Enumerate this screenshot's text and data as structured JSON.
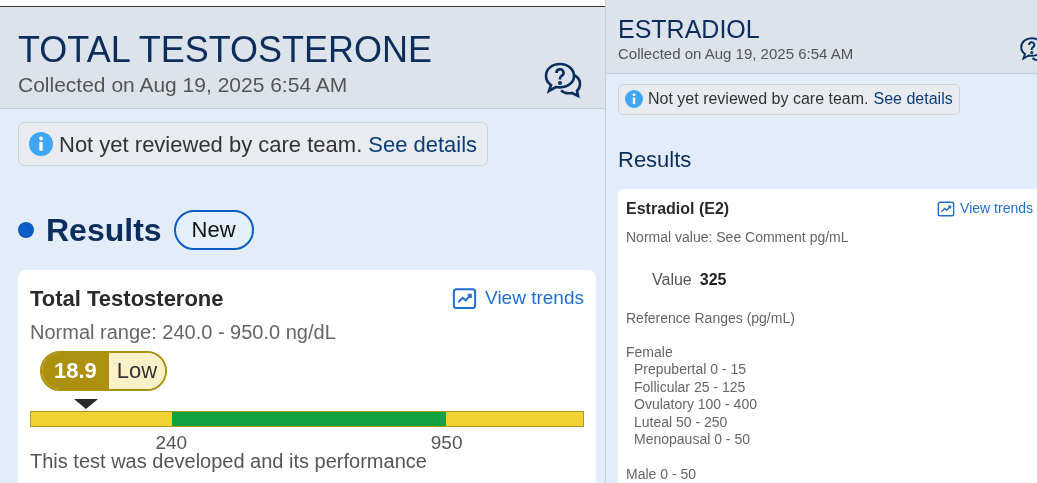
{
  "panels": [
    {
      "title": "TOTAL TESTOSTERONE",
      "collected": "Collected on Aug 19, 2025 6:54 AM",
      "notice": {
        "text": "Not yet reviewed by care team.",
        "link": "See details"
      },
      "results": {
        "heading": "Results",
        "badge": "New"
      },
      "result": {
        "kind": "range",
        "name": "Total Testosterone",
        "trend_link": "View trends",
        "normal": "Normal range: 240.0 - 950.0 ng/dL",
        "value": "18.9",
        "flag": "Low",
        "level": 0.1,
        "segments": [
          {
            "color": "#f2d233",
            "level": 0.255,
            "label": "240"
          },
          {
            "color": "#12a340",
            "level": 0.497,
            "label": "950"
          },
          {
            "color": "#f2d233",
            "level": 0.248
          }
        ],
        "note": "This test was developed and its performance"
      }
    },
    {
      "title": "ESTRADIOL",
      "collected": "Collected on Aug 19, 2025 6:54 AM",
      "notice": {
        "text": "Not yet reviewed by care team.",
        "link": "See details"
      },
      "results": {
        "heading": "Results"
      },
      "result": {
        "kind": "text",
        "name": "Estradiol (E2)",
        "trend_link": "View trends",
        "normal": "Normal value: See Comment pg/mL",
        "value_label": "Value",
        "value": "325",
        "reference": {
          "heading": "Reference Ranges (pg/mL)",
          "groups": [
            {
              "label": "Female",
              "children": [
                "Prepubertal 0 - 15",
                "Follicular 25 - 125",
                "Ovulatory 100 - 400",
                "Luteal 50 - 250",
                "Menopausal 0 - 50"
              ]
            },
            {
              "label": "Male 0 - 50"
            }
          ]
        }
      }
    }
  ]
}
